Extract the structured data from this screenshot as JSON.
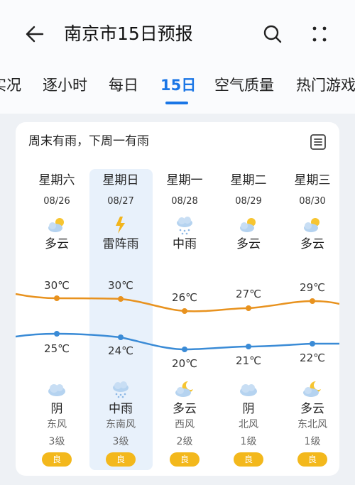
{
  "header": {
    "title": "南京市15日预报"
  },
  "tabs": [
    {
      "label": "实况"
    },
    {
      "label": "逐小时"
    },
    {
      "label": "每日"
    },
    {
      "label": "15日"
    },
    {
      "label": "空气质量"
    },
    {
      "label": "热门游戏"
    }
  ],
  "card": {
    "summary": "周末有雨，下周一有雨"
  },
  "colors": {
    "accent": "#1a76e6",
    "high_line": "#e8921e",
    "low_line": "#3a8bd6",
    "aqi_good": "#f3b81c"
  },
  "days": [
    {
      "weekday": "星期六",
      "date": "08/26",
      "day_icon": "partly-cloudy-sun-icon",
      "day_cond": "多云",
      "high": "30℃",
      "low": "25℃",
      "night_icon": "cloudy-icon",
      "night_cond": "阴",
      "wind": "东风",
      "level": "3级",
      "aqi": "良"
    },
    {
      "weekday": "星期日",
      "date": "08/27",
      "day_icon": "thunder-icon",
      "day_cond": "雷阵雨",
      "high": "30℃",
      "low": "24℃",
      "night_icon": "rain-cloud-icon",
      "night_cond": "中雨",
      "wind": "东南风",
      "level": "3级",
      "aqi": "良"
    },
    {
      "weekday": "星期一",
      "date": "08/28",
      "day_icon": "rain-cloud-icon",
      "day_cond": "中雨",
      "high": "26℃",
      "low": "20℃",
      "night_icon": "partly-cloudy-moon-icon",
      "night_cond": "多云",
      "wind": "西风",
      "level": "2级",
      "aqi": "良"
    },
    {
      "weekday": "星期二",
      "date": "08/29",
      "day_icon": "partly-cloudy-sun-icon",
      "day_cond": "多云",
      "high": "27℃",
      "low": "21℃",
      "night_icon": "cloudy-icon",
      "night_cond": "阴",
      "wind": "北风",
      "level": "1级",
      "aqi": "良"
    },
    {
      "weekday": "星期三",
      "date": "08/30",
      "day_icon": "partly-cloudy-sun-icon",
      "day_cond": "多云",
      "high": "29℃",
      "low": "22℃",
      "night_icon": "partly-cloudy-moon-icon",
      "night_cond": "多云",
      "wind": "东北风",
      "level": "1级",
      "aqi": "良"
    }
  ]
}
